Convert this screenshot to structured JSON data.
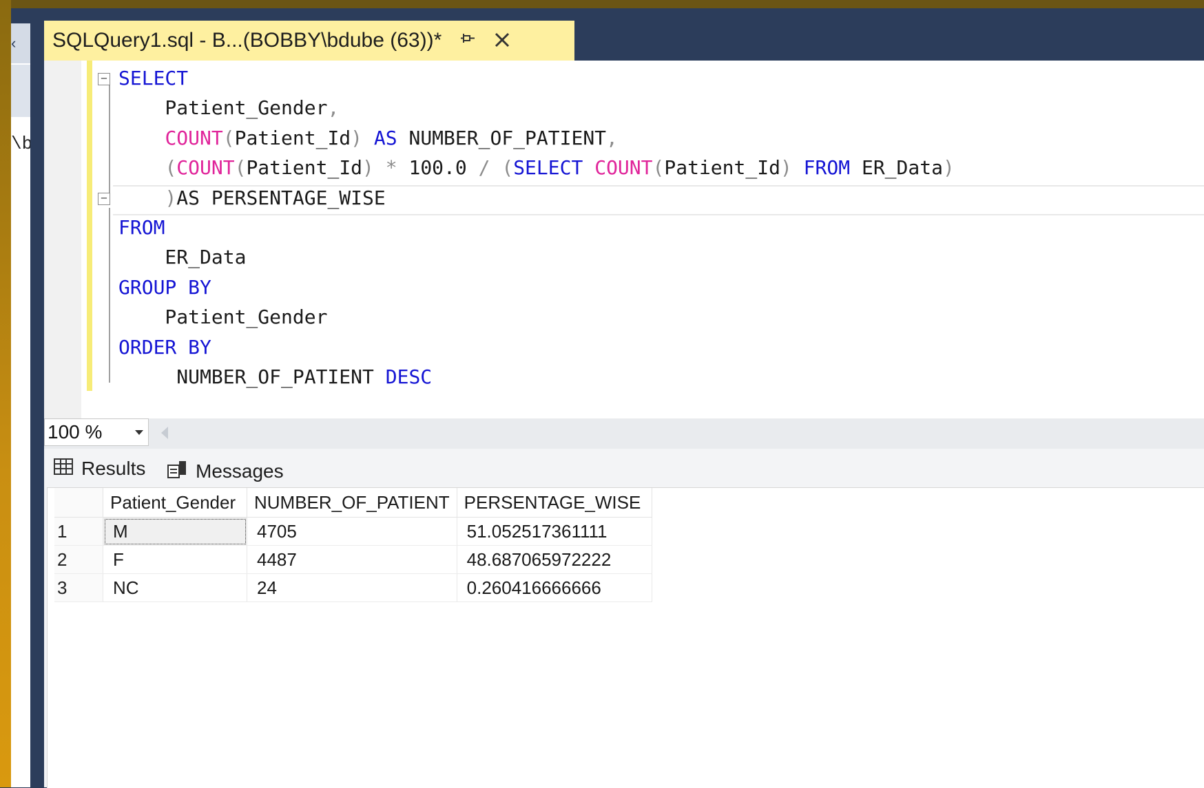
{
  "side_panel": {
    "top_glyph": "‹",
    "clipped_text": "\\b"
  },
  "document_tab": {
    "title": "SQLQuery1.sql - B...(BOBBY\\bdube (63))*",
    "pin_icon": "pin-icon",
    "close_icon": "close-icon"
  },
  "editor": {
    "fold_minus": "−",
    "lines": [
      [
        {
          "t": "SELECT",
          "c": "kw"
        }
      ],
      [
        {
          "t": "    Patient_Gender",
          "c": ""
        },
        {
          "t": ",",
          "c": "op"
        }
      ],
      [
        {
          "t": "    ",
          "c": ""
        },
        {
          "t": "COUNT",
          "c": "fn"
        },
        {
          "t": "(",
          "c": "op"
        },
        {
          "t": "Patient_Id",
          "c": ""
        },
        {
          "t": ")",
          "c": "op"
        },
        {
          "t": " ",
          "c": ""
        },
        {
          "t": "AS",
          "c": "kw"
        },
        {
          "t": " NUMBER_OF_PATIENT",
          "c": ""
        },
        {
          "t": ",",
          "c": "op"
        }
      ],
      [
        {
          "t": "    ",
          "c": ""
        },
        {
          "t": "(",
          "c": "op"
        },
        {
          "t": "COUNT",
          "c": "fn"
        },
        {
          "t": "(",
          "c": "op"
        },
        {
          "t": "Patient_Id",
          "c": ""
        },
        {
          "t": ")",
          "c": "op"
        },
        {
          "t": " ",
          "c": ""
        },
        {
          "t": "*",
          "c": "op"
        },
        {
          "t": " 100.0 ",
          "c": ""
        },
        {
          "t": "/",
          "c": "op"
        },
        {
          "t": " ",
          "c": ""
        },
        {
          "t": "(",
          "c": "op"
        },
        {
          "t": "SELECT",
          "c": "kw"
        },
        {
          "t": " ",
          "c": ""
        },
        {
          "t": "COUNT",
          "c": "fn"
        },
        {
          "t": "(",
          "c": "op"
        },
        {
          "t": "Patient_Id",
          "c": ""
        },
        {
          "t": ")",
          "c": "op"
        },
        {
          "t": " ",
          "c": ""
        },
        {
          "t": "FROM",
          "c": "kw"
        },
        {
          "t": " ER_Data",
          "c": ""
        },
        {
          "t": ")",
          "c": "op"
        }
      ],
      [
        {
          "t": "    ",
          "c": ""
        },
        {
          "t": ")",
          "c": "op"
        },
        {
          "t": "AS PERSENTAGE_WISE",
          "c": ""
        }
      ],
      [
        {
          "t": "FROM",
          "c": "kw"
        }
      ],
      [
        {
          "t": "    ER_Data",
          "c": ""
        }
      ],
      [
        {
          "t": "GROUP BY",
          "c": "kw"
        }
      ],
      [
        {
          "t": "    Patient_Gender",
          "c": ""
        }
      ],
      [
        {
          "t": "ORDER BY",
          "c": "kw"
        }
      ],
      [
        {
          "t": "     NUMBER_OF_PATIENT ",
          "c": ""
        },
        {
          "t": "DESC",
          "c": "kw"
        }
      ]
    ]
  },
  "zoom": {
    "value": "100 %",
    "caret": "▼"
  },
  "result_tabs": {
    "results_label": "Results",
    "messages_label": "Messages"
  },
  "results_grid": {
    "columns": [
      "Patient_Gender",
      "NUMBER_OF_PATIENT",
      "PERSENTAGE_WISE"
    ],
    "rows": [
      {
        "num": "1",
        "gender": "M",
        "count": "4705",
        "pct": "51.052517361111"
      },
      {
        "num": "2",
        "gender": "F",
        "count": "4487",
        "pct": "48.687065972222"
      },
      {
        "num": "3",
        "gender": "NC",
        "count": "24",
        "pct": "0.260416666666"
      }
    ]
  },
  "colors": {
    "keyword": "#1414d4",
    "function": "#e0249a",
    "operator": "#8c8c8c",
    "tab_active": "#fef0a0",
    "chrome": "#2c3d5b"
  }
}
